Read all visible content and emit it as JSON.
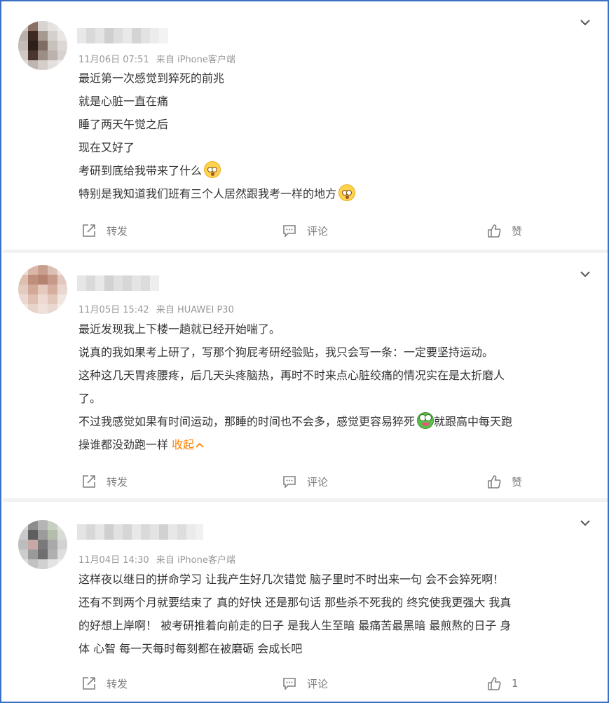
{
  "posts": [
    {
      "time": "11月06日 07:51",
      "source": "来自 iPhone客户端",
      "lines": [
        "最近第一次感觉到猝死的前兆",
        "就是心脏一直在痛",
        "睡了两天午觉之后",
        "现在又好了",
        "考研到底给我带来了什么",
        "特别是我知道我们班有三个人居然跟我考一样的地方"
      ],
      "actions": {
        "forward": "转发",
        "comment": "评论",
        "like": "赞"
      }
    },
    {
      "time": "11月05日 15:42",
      "source": "来自 HUAWEI P30",
      "lines": [
        "最近发现我上下楼一趟就已经开始喘了。",
        "说真的我如果考上研了，写那个狗屁考研经验贴，我只会写一条：一定要坚持运动。",
        "这种这几天胃疼腰疼，后几天头疼脑热，再时不时来点心脏绞痛的情况实在是太折磨人",
        "了。",
        "不过我感觉如果有时间运动，那睡的时间也不会多，感觉更容易猝死",
        "就跟高中每天跑",
        "操谁都没劲跑一样"
      ],
      "collapse": "收起",
      "actions": {
        "forward": "转发",
        "comment": "评论",
        "like": "赞"
      }
    },
    {
      "time": "11月04日 14:30",
      "source": "来自 iPhone客户端",
      "lines": [
        "这样夜以继日的拼命学习 让我产生好几次错觉 脑子里时不时出来一句 会不会猝死啊！",
        "还有不到两个月就要结束了 真的好快 还是那句话 那些杀不死我的 终究使我更强大 我真",
        "的好想上岸啊！ 被考研推着向前走的日子 是我人生至暗 最痛苦最黑暗 最煎熬的日子 身",
        "体 心智 每一天每时每刻都在被磨砺 会成长吧"
      ],
      "actions": {
        "forward": "转发",
        "comment": "评论",
        "like": "1"
      }
    }
  ],
  "colors": {
    "frame": "#3b6fc4",
    "meta": "#999999",
    "text": "#333333",
    "action": "#808080",
    "collapse": "#ff8200",
    "separator": "#f2f2f2"
  },
  "icons": [
    "chevron-down-icon",
    "forward-icon",
    "comment-icon",
    "like-icon",
    "flushed-emoji-icon",
    "frog-emoji-icon"
  ]
}
